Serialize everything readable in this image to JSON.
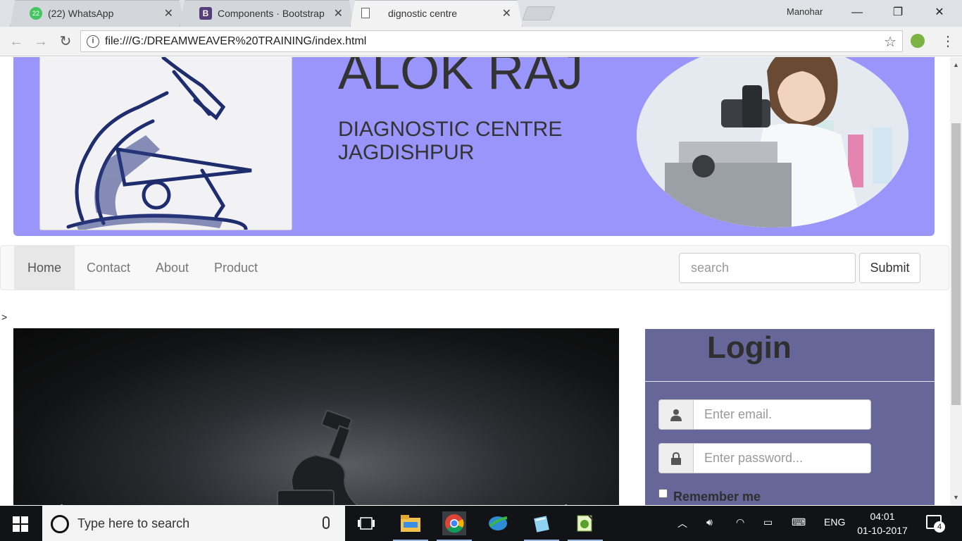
{
  "browser": {
    "tabs": [
      {
        "title": "(22) WhatsApp",
        "badge": "22",
        "active": false
      },
      {
        "title": "Components · Bootstrap",
        "badge": "B",
        "active": false
      },
      {
        "title": "dignostic centre",
        "active": true
      }
    ],
    "profile_name": "Manohar",
    "url": "file:///G:/DREAMWEAVER%20TRAINING/index.html"
  },
  "page": {
    "banner": {
      "title": "ALOK RAJ",
      "subtitle": "DIAGNOSTIC CENTRE JAGDISHPUR"
    },
    "stray_marks": [
      ">",
      ">"
    ],
    "nav": {
      "items": [
        {
          "label": "Home",
          "active": true
        },
        {
          "label": "Contact",
          "active": false
        },
        {
          "label": "About",
          "active": false
        },
        {
          "label": "Product",
          "active": false
        }
      ],
      "search_placeholder": "search",
      "submit_label": "Submit"
    },
    "carousel": {
      "prev_icon": "‹",
      "next_icon": "›"
    },
    "login": {
      "title": "Login",
      "email_placeholder": "Enter email.",
      "password_placeholder": "Enter password...",
      "remember_label": "Remember me",
      "email_icon": "user-icon",
      "password_icon": "lock-icon"
    }
  },
  "taskbar": {
    "search_placeholder": "Type here to search",
    "language": "ENG",
    "time": "04:01",
    "date": "01-10-2017",
    "notification_count": "4"
  },
  "colors": {
    "banner_bg": "#9995fa",
    "login_bg": "#666699",
    "navbar_bg": "#f8f8f8"
  }
}
